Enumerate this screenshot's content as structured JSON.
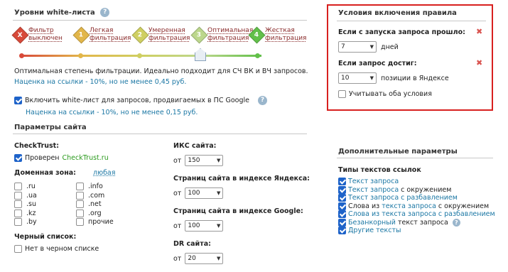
{
  "whitelist": {
    "title": "Уровни white-листа",
    "levels": [
      {
        "num": "X",
        "label": "Фильтр выключен",
        "color": "#d84a3a"
      },
      {
        "num": "1",
        "label": "Легкая фильтрация",
        "color": "#e2b64a"
      },
      {
        "num": "2",
        "label": "Умеренная фильтрация",
        "color": "#cfcf62"
      },
      {
        "num": "3",
        "label": "Оптимальная фильтрация",
        "color": "#bcd78c"
      },
      {
        "num": "4",
        "label": "Жесткая фильтрация",
        "color": "#62c04a"
      }
    ],
    "description": "Оптимальная степень фильтрации. Идеально подходит для СЧ ВК и ВЧ запросов.",
    "markup": "Наценка на ссылки - 10%, но не менее 0,45 руб.",
    "include_ps_google": "Включить white-лист для запросов, продвигаемых в ПС Google",
    "include_markup": "Наценка на ссылки - 10%, но не менее 0,15 руб."
  },
  "params": {
    "title": "Параметры сайта",
    "checktrust_label": "CheckTrust:",
    "verified_prefix": "Проверен",
    "verified_link": "CheckTrust.ru",
    "domain_label": "Доменная зона:",
    "domain_any": "любая",
    "zones_col1": [
      ".ru",
      ".ua",
      ".su",
      ".kz",
      ".by"
    ],
    "zones_col2": [
      ".info",
      ".com",
      ".net",
      ".org",
      "прочие"
    ],
    "blacklist_label": "Черный список:",
    "blacklist_option": "Нет в черном списке",
    "iks_label": "ИКС сайта:",
    "iks_from": "от",
    "iks_value": "150",
    "yandex_pages_label": "Страниц сайта в индексе Яндекса:",
    "yandex_from": "от",
    "yandex_value": "100",
    "google_pages_label": "Страниц сайта в индексе Google:",
    "google_from": "от",
    "google_value": "100",
    "dr_label": "DR сайта:",
    "dr_from": "от",
    "dr_value": "20"
  },
  "conditions": {
    "title": "Условия включения правила",
    "since_start_label": "Если с запуска запроса прошло:",
    "since_start_value": "7",
    "since_start_unit": "дней",
    "reached_label": "Если запрос достиг:",
    "reached_value": "10",
    "reached_unit": "позиции в Яндексе",
    "both_label": "Учитывать оба условия"
  },
  "extra": {
    "title": "Дополнительные параметры",
    "types_label": "Типы текстов ссылок",
    "options": [
      {
        "text": "Текст запроса",
        "link": true
      },
      {
        "text": "Текст запроса",
        "suffix": " с окружением",
        "link": true
      },
      {
        "text": "Текст запроса с разбавлением",
        "link": true
      },
      {
        "prefix": "Слова из ",
        "text": "текста запроса",
        "suffix": " с окружением",
        "link": true
      },
      {
        "text": "Слова из текста запроса с разбавлением",
        "link": true
      },
      {
        "text": "Безанкорный",
        "suffix": " текст запроса",
        "link": true,
        "help": true
      },
      {
        "text": "Другие тексты",
        "link": true
      }
    ]
  }
}
